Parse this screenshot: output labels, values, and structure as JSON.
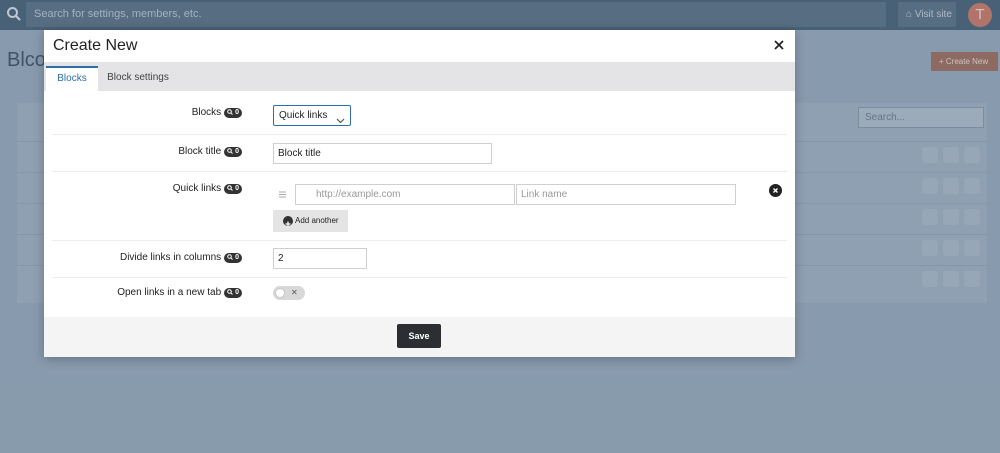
{
  "topbar": {
    "search_placeholder": "Search for settings, members, etc.",
    "visit_site": "Visit site",
    "avatar_initial": "T"
  },
  "background": {
    "page_title": "Blco",
    "create_new_label": "Create New",
    "search_placeholder": "Search..."
  },
  "modal": {
    "title": "Create New",
    "tabs": [
      {
        "label": "Blocks",
        "active": true
      },
      {
        "label": "Block settings",
        "active": false
      }
    ],
    "badge_count": "0",
    "fields": {
      "blocks": {
        "label": "Blocks",
        "value": "Quick links"
      },
      "block_title": {
        "label": "Block title",
        "value": "Block title"
      },
      "quick_links": {
        "label": "Quick links",
        "url_placeholder": "http://example.com",
        "name_placeholder": "Link name",
        "add_another": "Add another"
      },
      "columns": {
        "label": "Divide links in columns",
        "value": "2"
      },
      "new_tab": {
        "label": "Open links in a new tab",
        "checked": false
      }
    },
    "save_label": "Save"
  },
  "colors": {
    "accent": "#2d6ea8",
    "save_button": "#2b2f33",
    "create_new": "#9d6f61"
  }
}
